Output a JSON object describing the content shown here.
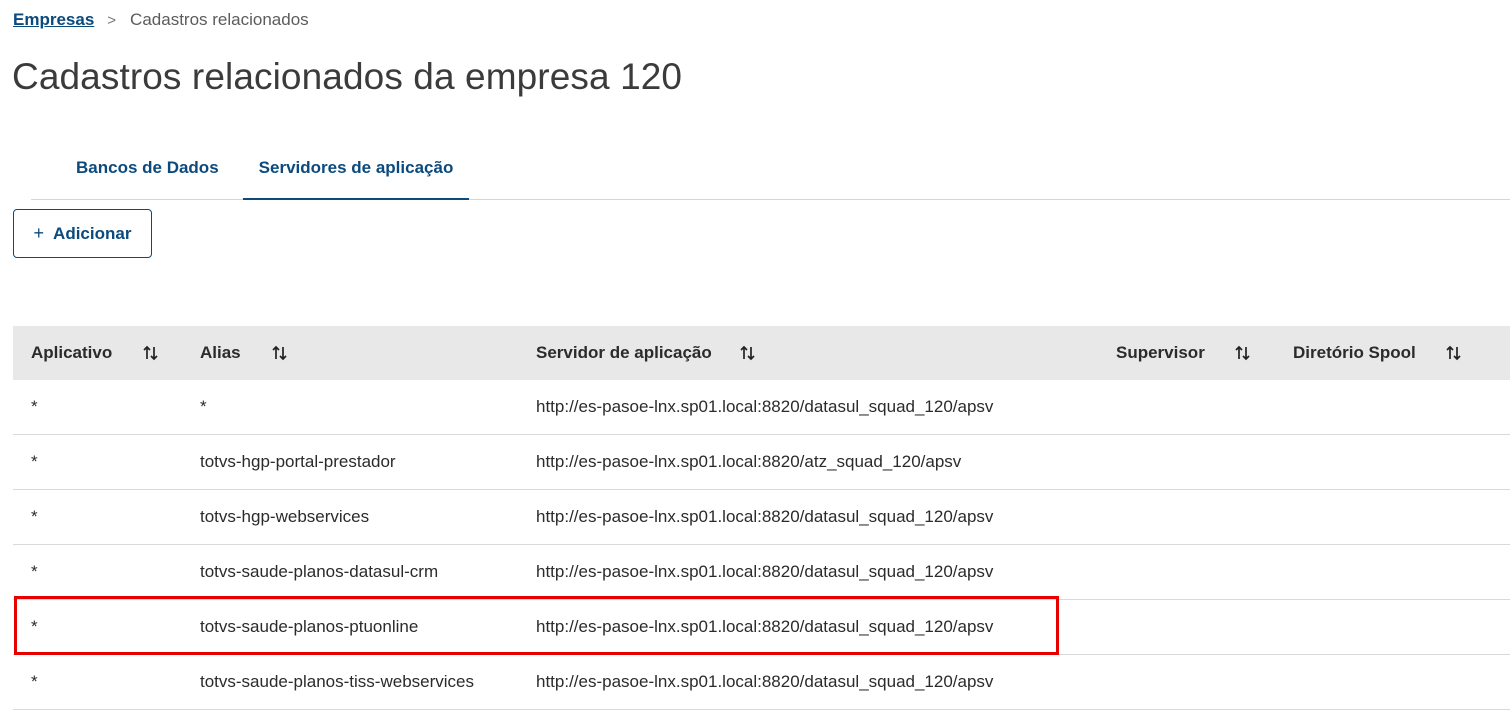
{
  "breadcrumb": {
    "root": "Empresas",
    "separator": ">",
    "current": "Cadastros relacionados"
  },
  "page_title": "Cadastros relacionados da empresa 120",
  "tabs": [
    {
      "label": "Bancos de Dados",
      "active": false
    },
    {
      "label": "Servidores de aplicação",
      "active": true
    }
  ],
  "toolbar": {
    "add_icon": "+",
    "add_label": "Adicionar"
  },
  "table": {
    "columns": [
      "Aplicativo",
      "Alias",
      "Servidor de aplicação",
      "Supervisor",
      "Diretório Spool"
    ],
    "sort_icon": "sort-up-down-icon",
    "rows": [
      {
        "aplicativo": "*",
        "alias": "*",
        "servidor": "http://es-pasoe-lnx.sp01.local:8820/datasul_squad_120/apsv",
        "supervisor": "",
        "spool": ""
      },
      {
        "aplicativo": "*",
        "alias": "totvs-hgp-portal-prestador",
        "servidor": "http://es-pasoe-lnx.sp01.local:8820/atz_squad_120/apsv",
        "supervisor": "",
        "spool": ""
      },
      {
        "aplicativo": "*",
        "alias": "totvs-hgp-webservices",
        "servidor": "http://es-pasoe-lnx.sp01.local:8820/datasul_squad_120/apsv",
        "supervisor": "",
        "spool": ""
      },
      {
        "aplicativo": "*",
        "alias": "totvs-saude-planos-datasul-crm",
        "servidor": "http://es-pasoe-lnx.sp01.local:8820/datasul_squad_120/apsv",
        "supervisor": "",
        "spool": ""
      },
      {
        "aplicativo": "*",
        "alias": "totvs-saude-planos-ptuonline",
        "servidor": "http://es-pasoe-lnx.sp01.local:8820/datasul_squad_120/apsv",
        "supervisor": "",
        "spool": ""
      },
      {
        "aplicativo": "*",
        "alias": "totvs-saude-planos-tiss-webservices",
        "servidor": "http://es-pasoe-lnx.sp01.local:8820/datasul_squad_120/apsv",
        "supervisor": "",
        "spool": ""
      }
    ]
  },
  "colors": {
    "primary": "#0c4a7d",
    "header_bg": "#e8e8e8",
    "highlight": "#e60000"
  }
}
